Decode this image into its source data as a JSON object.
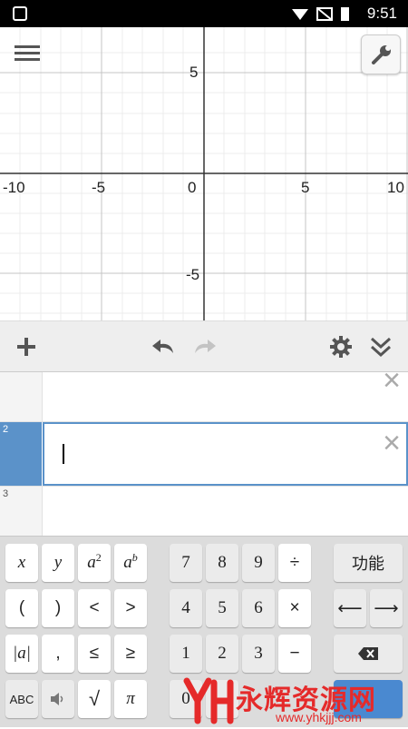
{
  "status_bar": {
    "time": "9:51"
  },
  "graph": {
    "x_ticks": [
      "-10",
      "-5",
      "0",
      "5",
      "10"
    ],
    "y_ticks": [
      "5",
      "-5"
    ]
  },
  "expressions": [
    {
      "number": "",
      "text": ""
    },
    {
      "number": "2",
      "text": ""
    },
    {
      "number": "3",
      "text": ""
    }
  ],
  "keypad": {
    "x": "x",
    "y": "y",
    "a": "a",
    "two": "2",
    "b": "b",
    "open_paren": "(",
    "close_paren": ")",
    "lt": "<",
    "gt": ">",
    "abs": "|a|",
    "comma": ",",
    "le": "≤",
    "ge": "≥",
    "abc": "ABC",
    "sqrt": "√",
    "pi": "π",
    "n7": "7",
    "n8": "8",
    "n9": "9",
    "div": "÷",
    "n4": "4",
    "n5": "5",
    "n6": "6",
    "mul": "×",
    "n1": "1",
    "n2": "2",
    "n3": "3",
    "minus": "−",
    "n0": "0",
    "func": "功能",
    "left_arrow": "⟵",
    "right_arrow": "⟶"
  },
  "watermark": {
    "name": "永辉资源网",
    "url": "www.yhkjjj.com"
  },
  "colors": {
    "accent": "#5b92c9",
    "enter": "#4a89d0",
    "watermark": "#e52a2a"
  }
}
